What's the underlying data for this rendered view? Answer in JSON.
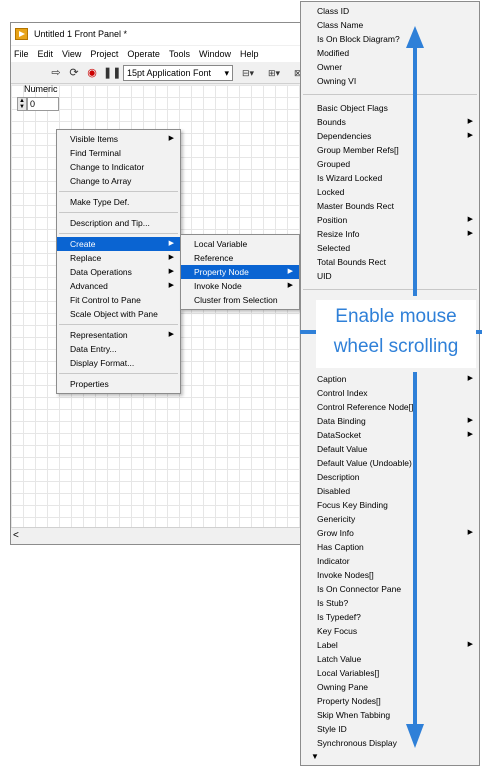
{
  "window": {
    "title": "Untitled 1 Front Panel *",
    "menu": [
      "File",
      "Edit",
      "View",
      "Project",
      "Operate",
      "Tools",
      "Window",
      "Help"
    ],
    "font_select": "15pt Application Font",
    "hscroll_left": "<"
  },
  "numeric": {
    "label": "Numeric",
    "value": "0"
  },
  "context_menu": {
    "items": [
      {
        "label": "Visible Items",
        "submenu": true
      },
      {
        "label": "Find Terminal"
      },
      {
        "label": "Change to Indicator"
      },
      {
        "label": "Change to Array"
      },
      {
        "sep": true
      },
      {
        "label": "Make Type Def."
      },
      {
        "sep": true
      },
      {
        "label": "Description and Tip..."
      },
      {
        "sep": true
      },
      {
        "label": "Create",
        "submenu": true,
        "highlighted": true
      },
      {
        "label": "Replace",
        "submenu": true
      },
      {
        "label": "Data Operations",
        "submenu": true
      },
      {
        "label": "Advanced",
        "submenu": true
      },
      {
        "label": "Fit Control to Pane"
      },
      {
        "label": "Scale Object with Pane"
      },
      {
        "sep": true
      },
      {
        "label": "Representation",
        "submenu": true
      },
      {
        "label": "Data Entry..."
      },
      {
        "label": "Display Format..."
      },
      {
        "sep": true
      },
      {
        "label": "Properties"
      }
    ]
  },
  "create_menu": {
    "items": [
      {
        "label": "Local Variable"
      },
      {
        "label": "Reference"
      },
      {
        "label": "Property Node",
        "submenu": true,
        "highlighted": true
      },
      {
        "label": "Invoke Node",
        "submenu": true
      },
      {
        "label": "Cluster from Selection"
      }
    ]
  },
  "property_list": {
    "group1": [
      {
        "label": "Class ID"
      },
      {
        "label": "Class Name"
      },
      {
        "label": "Is On Block Diagram?"
      },
      {
        "label": "Modified"
      },
      {
        "label": "Owner"
      },
      {
        "label": "Owning VI"
      }
    ],
    "group2": [
      {
        "label": "Basic Object Flags"
      },
      {
        "label": "Bounds",
        "submenu": true
      },
      {
        "label": "Dependencies",
        "submenu": true
      },
      {
        "label": "Group Member Refs[]"
      },
      {
        "label": "Grouped"
      },
      {
        "label": "Is Wizard Locked"
      },
      {
        "label": "Locked"
      },
      {
        "label": "Master Bounds Rect"
      },
      {
        "label": "Position",
        "submenu": true
      },
      {
        "label": "Resize Info",
        "submenu": true
      },
      {
        "label": "Selected"
      },
      {
        "label": "Total Bounds Rect"
      },
      {
        "label": "UID"
      }
    ],
    "group3": [
      {
        "label": "Caption",
        "submenu": true
      },
      {
        "label": "Control Index"
      },
      {
        "label": "Control Reference Node[]"
      },
      {
        "label": "Data Binding",
        "submenu": true
      },
      {
        "label": "DataSocket",
        "submenu": true
      },
      {
        "label": "Default Value"
      },
      {
        "label": "Default Value (Undoable)"
      },
      {
        "label": "Description"
      },
      {
        "label": "Disabled"
      },
      {
        "label": "Focus Key Binding"
      },
      {
        "label": "Genericity"
      },
      {
        "label": "Grow Info",
        "submenu": true
      },
      {
        "label": "Has Caption"
      },
      {
        "label": "Indicator"
      },
      {
        "label": "Invoke Nodes[]"
      },
      {
        "label": "Is On Connector Pane"
      },
      {
        "label": "Is Stub?"
      },
      {
        "label": "Is Typedef?"
      },
      {
        "label": "Key Focus"
      },
      {
        "label": "Label",
        "submenu": true
      },
      {
        "label": "Latch Value"
      },
      {
        "label": "Local Variables[]"
      },
      {
        "label": "Owning Pane"
      },
      {
        "label": "Property Nodes[]"
      },
      {
        "label": "Skip When Tabbing"
      },
      {
        "label": "Style ID"
      },
      {
        "label": "Synchronous Display"
      }
    ]
  },
  "overlay": {
    "line1": "Enable mouse",
    "line2": "wheel scrolling",
    "color": "#2f80d8"
  }
}
